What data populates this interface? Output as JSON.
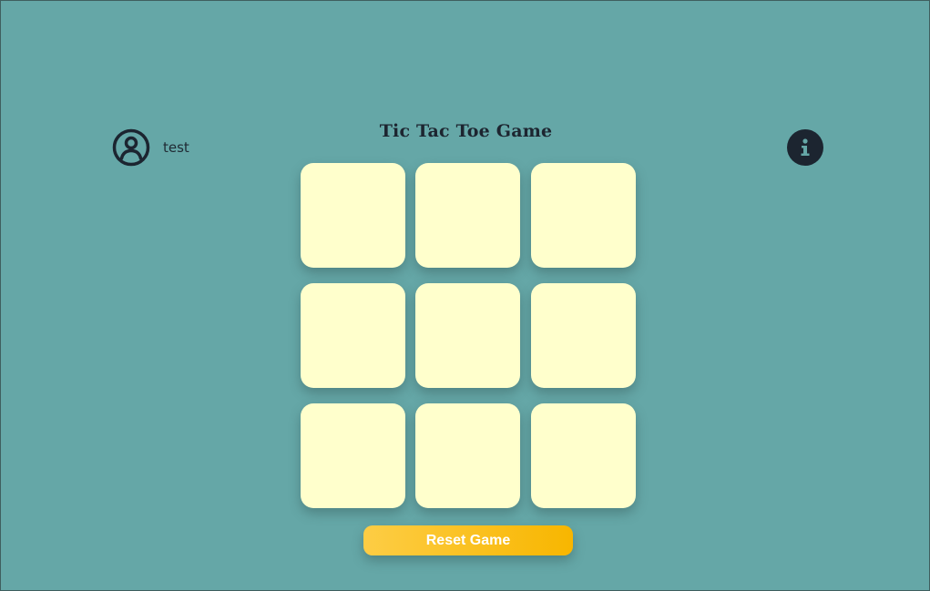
{
  "user": {
    "icon": "user-circle-icon",
    "name": "test"
  },
  "title": "Tic Tac Toe Game",
  "info": {
    "icon": "info-icon",
    "color": "#1c2530"
  },
  "board": {
    "cells": [
      "",
      "",
      "",
      "",
      "",
      "",
      "",
      "",
      ""
    ],
    "cell_color": "#ffffcc"
  },
  "reset_button": {
    "label": "Reset Game",
    "colors": [
      "#fdcd45",
      "#f8b600"
    ]
  },
  "background_color": "#65a7a7"
}
